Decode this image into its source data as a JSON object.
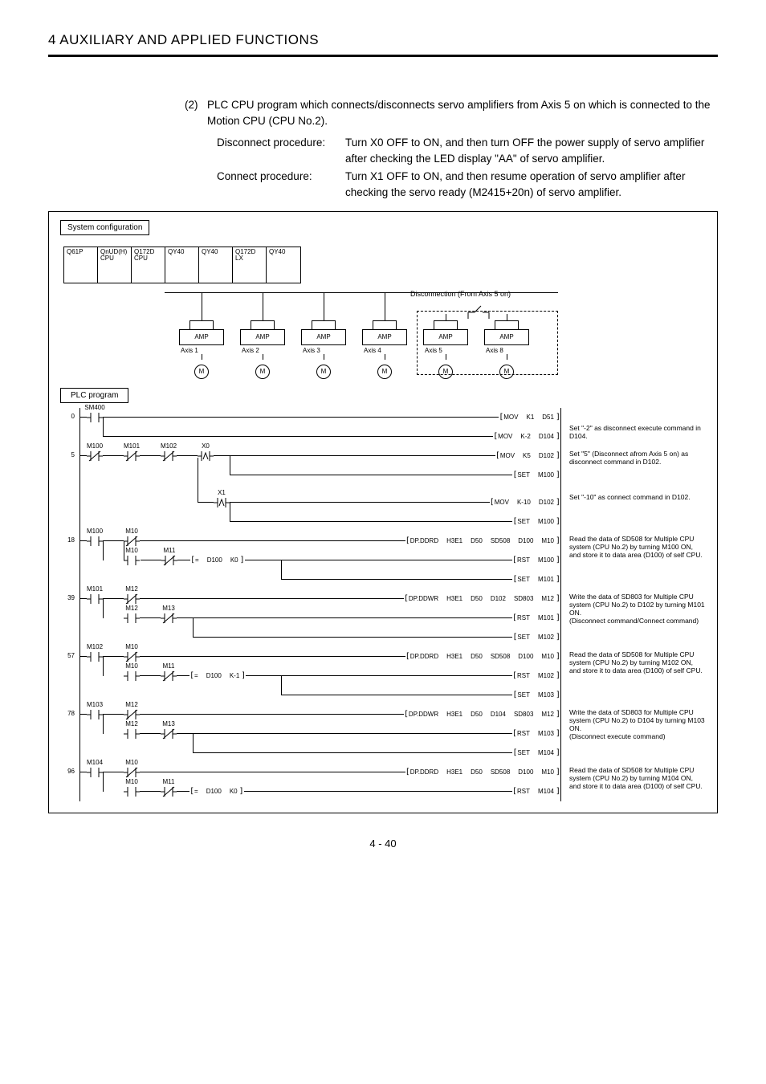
{
  "header": "4   AUXILIARY AND APPLIED FUNCTIONS",
  "intro_num": "(2)",
  "intro_text_1": "PLC CPU program which connects/disconnects servo amplifiers from Axis 5 on which is connected to the Motion CPU (CPU No.2).",
  "proc": [
    {
      "label": "Disconnect procedure:",
      "text": "Turn X0 OFF to ON, and then turn OFF the power supply of servo amplifier after checking the LED display \"AA\" of servo amplifier."
    },
    {
      "label": "Connect procedure:",
      "text": "Turn X1 OFF to ON, and then resume operation of servo amplifier after checking the servo ready (M2415+20n) of servo amplifier."
    }
  ],
  "sys_conf_label": "System configuration",
  "slots": [
    "Q61P",
    "QnUD(H)\nCPU",
    "Q172D\nCPU",
    "QY40",
    "QY40",
    "Q172D\nLX",
    "QY40"
  ],
  "amps": [
    {
      "axis": "Axis 1"
    },
    {
      "axis": "Axis 2"
    },
    {
      "axis": "Axis 3"
    },
    {
      "axis": "Axis 4"
    },
    {
      "axis": "Axis 5"
    },
    {
      "axis": "Axis 8"
    }
  ],
  "amp_label": "AMP",
  "motor_label": "M",
  "disconnect_label": "Disconnection (From Axis 5 on)",
  "plc_prog_label": "PLC program",
  "rungs": {
    "r0": {
      "step": "0",
      "contact": "SM400",
      "coils": [
        {
          "op": "MOV",
          "a": "K1",
          "b": "D51"
        },
        {
          "op": "MOV",
          "a": "K-2",
          "b": "D104"
        }
      ],
      "note1": "Set \"-2\" as disconnect execute command in D104."
    },
    "r5": {
      "step": "5",
      "contacts": [
        "M100",
        "M101",
        "M102",
        "X0"
      ],
      "coils": [
        {
          "op": "MOV",
          "a": "K5",
          "b": "D102"
        },
        {
          "op": "SET",
          "a": "",
          "b": "M100"
        }
      ],
      "note": "Set \"5\" (Disconnect afrom Axis 5 on) as disconnect command in D102.",
      "branch_contact": "X1",
      "branch_coils": [
        {
          "op": "MOV",
          "a": "K-10",
          "b": "D102"
        },
        {
          "op": "SET",
          "a": "",
          "b": "M100"
        }
      ],
      "branch_note": "Set \"-10\" as connect command in D102."
    },
    "r18": {
      "step": "18",
      "contacts": [
        "M100",
        "M10"
      ],
      "coil_long": {
        "op": "DP.DDRD",
        "a": "H3E1",
        "b": "D50",
        "c": "SD508",
        "d": "D100",
        "e": "M10"
      },
      "sub_contacts": [
        "M10",
        "M11"
      ],
      "sub_cmp": {
        "op": "=",
        "a": "D100",
        "b": "K0"
      },
      "sub_coils": [
        {
          "op": "RST",
          "a": "",
          "b": "M100"
        },
        {
          "op": "SET",
          "a": "",
          "b": "M101"
        }
      ],
      "note": "Read the data of SD508 for Multiple CPU system (CPU No.2) by turning M100 ON, and store it to data area (D100) of self CPU."
    },
    "r39": {
      "step": "39",
      "contacts": [
        "M101",
        "M12"
      ],
      "coil_long": {
        "op": "DP.DDWR",
        "a": "H3E1",
        "b": "D50",
        "c": "D102",
        "d": "SD803",
        "e": "M12"
      },
      "sub_contacts": [
        "M12",
        "M13"
      ],
      "sub_coils": [
        {
          "op": "RST",
          "a": "",
          "b": "M101"
        },
        {
          "op": "SET",
          "a": "",
          "b": "M102"
        }
      ],
      "note": "Write the data of SD803 for Multiple CPU system (CPU No.2) to D102 by turning M101 ON.\n(Disconnect command/Connect command)"
    },
    "r57": {
      "step": "57",
      "contacts": [
        "M102",
        "M10"
      ],
      "coil_long": {
        "op": "DP.DDRD",
        "a": "H3E1",
        "b": "D50",
        "c": "SD508",
        "d": "D100",
        "e": "M10"
      },
      "sub_contacts": [
        "M10",
        "M11"
      ],
      "sub_cmp": {
        "op": "=",
        "a": "D100",
        "b": "K-1"
      },
      "sub_coils": [
        {
          "op": "RST",
          "a": "",
          "b": "M102"
        },
        {
          "op": "SET",
          "a": "",
          "b": "M103"
        }
      ],
      "note": "Read the data of SD508 for Multiple CPU system (CPU No.2) by turning M102 ON, and store it to data area (D100) of self CPU."
    },
    "r78": {
      "step": "78",
      "contacts": [
        "M103",
        "M12"
      ],
      "coil_long": {
        "op": "DP.DDWR",
        "a": "H3E1",
        "b": "D50",
        "c": "D104",
        "d": "SD803",
        "e": "M12"
      },
      "sub_contacts": [
        "M12",
        "M13"
      ],
      "sub_coils": [
        {
          "op": "RST",
          "a": "",
          "b": "M103"
        },
        {
          "op": "SET",
          "a": "",
          "b": "M104"
        }
      ],
      "note": "Write the data of SD803 for Multiple CPU system (CPU No.2) to D104 by turning M103 ON.\n(Disconnect execute command)"
    },
    "r96": {
      "step": "96",
      "contacts": [
        "M104",
        "M10"
      ],
      "coil_long": {
        "op": "DP.DDRD",
        "a": "H3E1",
        "b": "D50",
        "c": "SD508",
        "d": "D100",
        "e": "M10"
      },
      "sub_contacts": [
        "M10",
        "M11"
      ],
      "sub_cmp": {
        "op": "=",
        "a": "D100",
        "b": "K0"
      },
      "sub_coils": [
        {
          "op": "RST",
          "a": "",
          "b": "M104"
        }
      ],
      "note": "Read the data of SD508 for Multiple CPU system (CPU No.2) by turning M104 ON, and store it to data area (D100) of self CPU."
    }
  },
  "page_num": "4 - 40"
}
